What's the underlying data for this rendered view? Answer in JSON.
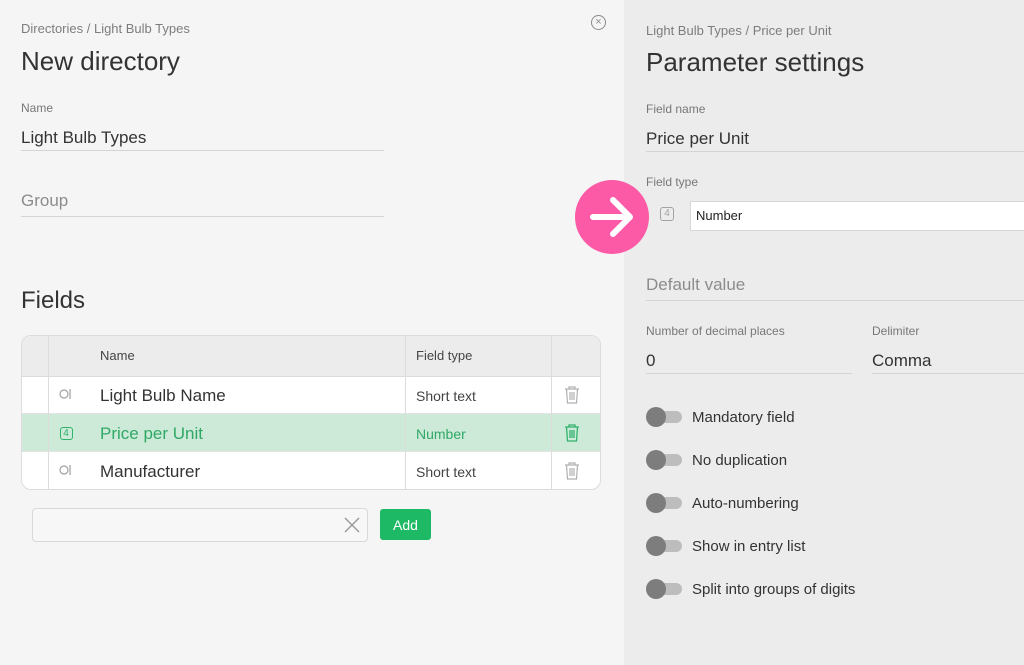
{
  "left": {
    "breadcrumb": "Directories / Light Bulb Types",
    "title": "New directory",
    "name_label": "Name",
    "name_value": "Light Bulb Types",
    "group_placeholder": "Group",
    "fields_title": "Fields",
    "table": {
      "headers": {
        "name": "Name",
        "type": "Field type"
      },
      "rows": [
        {
          "icon": "search-field-icon",
          "name": "Light Bulb Name",
          "type": "Short text",
          "selected": false
        },
        {
          "icon": "number-field-icon",
          "name": "Price per Unit",
          "type": "Number",
          "selected": true
        },
        {
          "icon": "search-field-icon",
          "name": "Manufacturer",
          "type": "Short text",
          "selected": false
        }
      ]
    },
    "add_input_value": "",
    "add_button": "Add"
  },
  "right": {
    "breadcrumb": "Light Bulb Types / Price per Unit",
    "title": "Parameter settings",
    "field_name_label": "Field name",
    "field_name_value": "Price per Unit",
    "field_type_label": "Field type",
    "field_type_value": "Number",
    "field_type_icon_digit": "4",
    "default_value_placeholder": "Default value",
    "decimal_label": "Number of decimal places",
    "decimal_value": "0",
    "delimiter_label": "Delimiter",
    "delimiter_value": "Comma",
    "toggles": [
      {
        "label": "Mandatory field",
        "on": false
      },
      {
        "label": "No duplication",
        "on": false
      },
      {
        "label": "Auto-numbering",
        "on": false
      },
      {
        "label": "Show in entry list",
        "on": false
      },
      {
        "label": "Split into groups of digits",
        "on": false
      }
    ]
  },
  "colors": {
    "accent_green": "#1eb964",
    "selected_row_bg": "#cde9d8",
    "highlight_pink": "#fc5aa6"
  },
  "number_icon_digit": "4"
}
